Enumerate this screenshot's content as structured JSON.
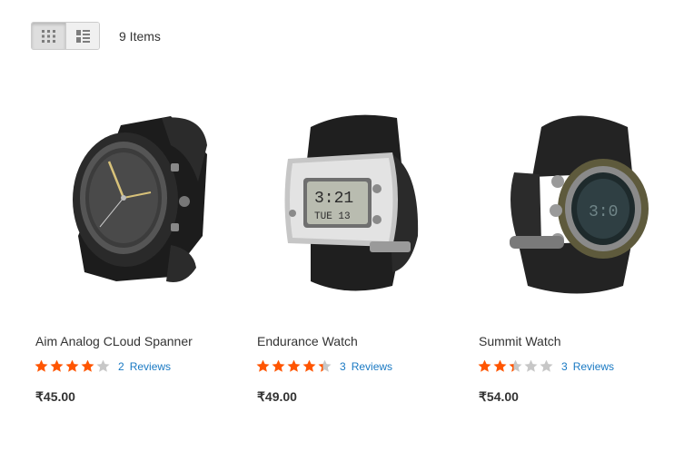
{
  "toolbar": {
    "modes": [
      {
        "icon": "grid-view-icon",
        "active": true
      },
      {
        "icon": "list-view-icon",
        "active": false
      }
    ],
    "count_label": "9 Items"
  },
  "colors": {
    "star_filled": "#ff5501",
    "star_empty": "#c7c7c7",
    "link": "#1979c3",
    "text": "#333333"
  },
  "products": [
    {
      "name": "Aim Analog CLoud Spanner",
      "rating": 0.8,
      "stars": 4,
      "review_count": "2",
      "reviews_label": "Reviews",
      "price": "₹45.00",
      "image": "analog-watch-image"
    },
    {
      "name": "Endurance Watch",
      "rating": 0.87,
      "stars": 4.35,
      "review_count": "3",
      "reviews_label": "Reviews",
      "price": "₹49.00",
      "image": "digital-watch-image"
    },
    {
      "name": "Summit Watch",
      "rating": 0.47,
      "stars": 2.35,
      "review_count": "3",
      "reviews_label": "Reviews",
      "price": "₹54.00",
      "image": "outdoor-watch-image"
    }
  ]
}
